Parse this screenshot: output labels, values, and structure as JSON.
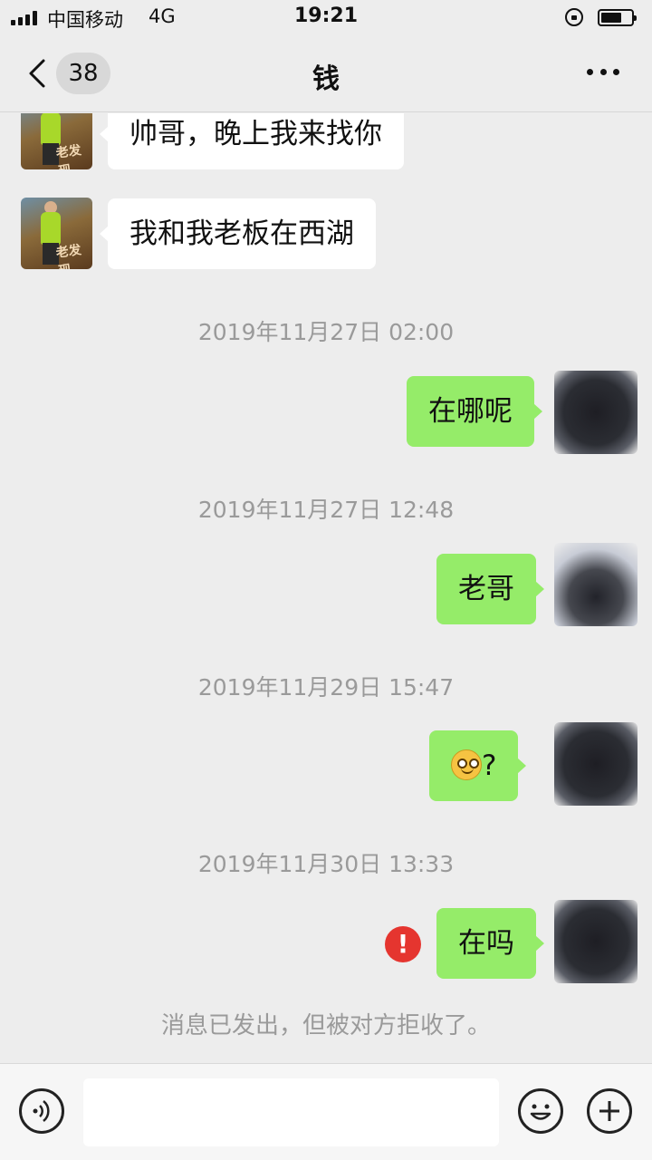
{
  "status_bar": {
    "carrier": "中国移动",
    "network": "4G",
    "time": "19:21",
    "battery_level": 0.7
  },
  "nav": {
    "unread_count": "38",
    "title": "钱"
  },
  "messages": [
    {
      "side": "left",
      "text": "帅哥，晚上我来找你"
    },
    {
      "side": "left",
      "text": "我和我老板在西湖"
    },
    {
      "type": "time",
      "text": "2019年11月27日 02:00"
    },
    {
      "side": "right",
      "text": "在哪呢"
    },
    {
      "type": "time",
      "text": "2019年11月27日 12:48"
    },
    {
      "side": "right",
      "text": "老哥"
    },
    {
      "type": "time",
      "text": "2019年11月29日 15:47"
    },
    {
      "side": "right",
      "emoji": "smile-emoji",
      "text": "?"
    },
    {
      "type": "time",
      "text": "2019年11月30日 13:33"
    },
    {
      "side": "right",
      "text": "在吗",
      "error": true
    },
    {
      "type": "system",
      "text": "消息已发出，但被对方拒收了。"
    }
  ],
  "avatar_watermark": "老发现",
  "colors": {
    "background": "#ededed",
    "sent_bubble": "#95ec69",
    "received_bubble": "#ffffff",
    "error": "#e5352f"
  }
}
